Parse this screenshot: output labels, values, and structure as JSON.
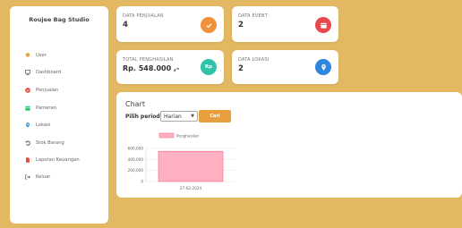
{
  "sidebar": {
    "brand": "Roujee Bag Studio",
    "items": [
      {
        "label": "User",
        "icon": "user-icon",
        "color": "#e8a43a"
      },
      {
        "label": "Dashboard",
        "icon": "monitor-icon",
        "color": "#555555"
      },
      {
        "label": "Penjualan",
        "icon": "check-circle-icon",
        "color": "#e74c3c"
      },
      {
        "label": "Pameran",
        "icon": "calendar-icon",
        "color": "#2ecc71"
      },
      {
        "label": "Lokasi",
        "icon": "map-pin-icon",
        "color": "#3498db"
      },
      {
        "label": "Stok Barang",
        "icon": "undo-icon",
        "color": "#2c3e50"
      },
      {
        "label": "Laporan Keuangan",
        "icon": "file-icon",
        "color": "#e74c3c"
      },
      {
        "label": "Keluar",
        "icon": "logout-icon",
        "color": "#555555"
      }
    ]
  },
  "cards": {
    "penjualan": {
      "label": "DATA PENJUALAN",
      "value": "4",
      "icon": "check-icon",
      "color": "#f0913c"
    },
    "event": {
      "label": "DATA EVENT",
      "value": "2",
      "icon": "calendar-icon",
      "color": "#e8494f"
    },
    "penghasilan": {
      "label": "TOTAL PENGHASILAN",
      "value": "Rp. 548.000 ,-",
      "icon": "rupiah-icon",
      "icon_text": "Rp",
      "color": "#2ec4a6"
    },
    "lokasi": {
      "label": "DATA LOKASI",
      "value": "2",
      "icon": "map-pin-icon",
      "color": "#2e86de"
    }
  },
  "chart": {
    "title": "Chart",
    "period_label": "Pilih periode:",
    "period_value": "Harian",
    "go_label": "Cari"
  },
  "chart_data": {
    "type": "bar",
    "categories": [
      "27-02-2024"
    ],
    "series": [
      {
        "name": "Penghasilan",
        "values": [
          548000
        ]
      }
    ],
    "ylim": [
      0,
      600000
    ],
    "yticks": [
      "600,000",
      "400,000",
      "200,000",
      "0"
    ],
    "legend": "top",
    "bar_color": "#ffb1c1",
    "bar_border": "#ff6384"
  }
}
